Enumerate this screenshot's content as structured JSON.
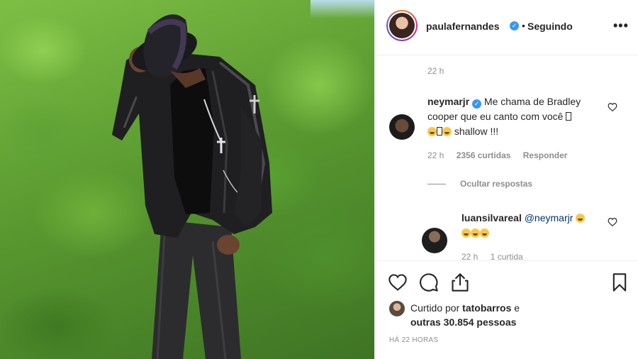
{
  "post": {
    "author": "paulafernandes",
    "follow_status": "Seguindo",
    "separator": "•"
  },
  "comments": {
    "top_time": "22 h",
    "first": {
      "username": "neymarjr",
      "text_line1": "Me chama de Bradley",
      "text_line2": "cooper que eu canto com você",
      "text_line3": "shallow !!!",
      "time": "22 h",
      "likes": "2356 curtidas",
      "reply": "Responder"
    },
    "hide_replies": "Ocultar respostas",
    "second": {
      "username": "luansilvareal",
      "mention": "@neymarjr",
      "time": "22 h",
      "likes": "1 curtida"
    }
  },
  "footer": {
    "liked_prefix": "Curtido por",
    "liked_user": "tatobarros",
    "liked_and": "e",
    "liked_others": "outras 30.854 pessoas",
    "post_time": "HÁ 22 HORAS"
  },
  "icons": {
    "verified": "verified-badge-icon",
    "more": "more-options-icon",
    "like": "heart-icon",
    "comment": "comment-icon",
    "share": "share-icon",
    "save": "bookmark-icon"
  },
  "colors": {
    "verified": "#3897f0",
    "text": "#262626",
    "muted": "#8e8e8e",
    "border": "#efefef",
    "mention": "#003569"
  }
}
